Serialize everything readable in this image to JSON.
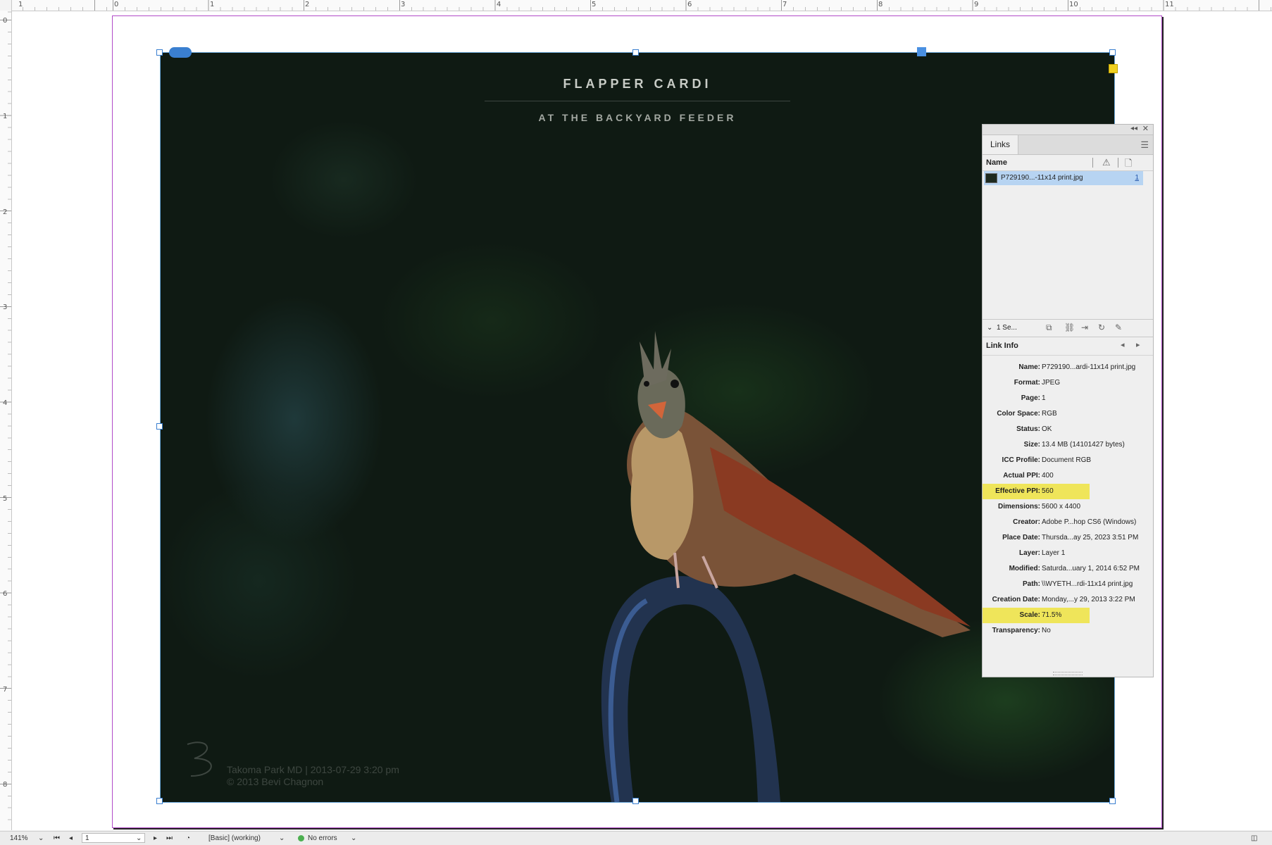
{
  "rulers": {
    "top_labels": [
      "1",
      "0",
      "1",
      "2",
      "3",
      "4",
      "5",
      "6",
      "7",
      "8",
      "9",
      "10",
      "11"
    ],
    "left_labels": [
      "0",
      "1",
      "2",
      "3",
      "4",
      "5",
      "6",
      "7",
      "8"
    ]
  },
  "document": {
    "title": "FLAPPER CARDI",
    "subtitle": "AT THE BACKYARD FEEDER",
    "watermark_line1": "Takoma Park MD | 2013-07-29 3:20 pm",
    "watermark_line2": "© 2013 Bevi Chagnon"
  },
  "links_panel": {
    "tab_label": "Links",
    "column_name": "Name",
    "link_item": {
      "name": "P729190...-11x14 print.jpg",
      "page": "1"
    },
    "selection_summary": "1 Se...",
    "link_info_title": "Link Info",
    "info": [
      {
        "key": "Name:",
        "value": "P729190...ardi-11x14 print.jpg",
        "highlight": false
      },
      {
        "key": "Format:",
        "value": "JPEG",
        "highlight": false
      },
      {
        "key": "Page:",
        "value": "1",
        "highlight": false
      },
      {
        "key": "Color Space:",
        "value": "RGB",
        "highlight": false
      },
      {
        "key": "Status:",
        "value": "OK",
        "highlight": false
      },
      {
        "key": "Size:",
        "value": "13.4 MB (14101427 bytes)",
        "highlight": false
      },
      {
        "key": "ICC Profile:",
        "value": "Document RGB",
        "highlight": false
      },
      {
        "key": "Actual PPI:",
        "value": "400",
        "highlight": false
      },
      {
        "key": "Effective PPI:",
        "value": "560",
        "highlight": true
      },
      {
        "key": "Dimensions:",
        "value": "5600 x 4400",
        "highlight": false
      },
      {
        "key": "Creator:",
        "value": "Adobe P...hop CS6 (Windows)",
        "highlight": false
      },
      {
        "key": "Place Date:",
        "value": "Thursda...ay 25, 2023 3:51 PM",
        "highlight": false
      },
      {
        "key": "Layer:",
        "value": "Layer 1",
        "highlight": false
      },
      {
        "key": "Modified:",
        "value": "Saturda...uary 1, 2014 6:52 PM",
        "highlight": false
      },
      {
        "key": "Path:",
        "value": "\\\\WYETH...rdi-11x14 print.jpg",
        "highlight": false
      },
      {
        "key": "Creation Date:",
        "value": "Monday,...y 29, 2013 3:22 PM",
        "highlight": false
      },
      {
        "key": "Scale:",
        "value": "71.5%",
        "highlight": true
      },
      {
        "key": "Transparency:",
        "value": "No",
        "highlight": false
      }
    ],
    "highlight_color": "#efe55a",
    "selection_color": "#b7d4f2"
  },
  "statusbar": {
    "zoom": "141%",
    "page": "1",
    "preflight_profile": "[Basic] (working)",
    "errors": "No errors",
    "status_color": "#4caf50"
  }
}
